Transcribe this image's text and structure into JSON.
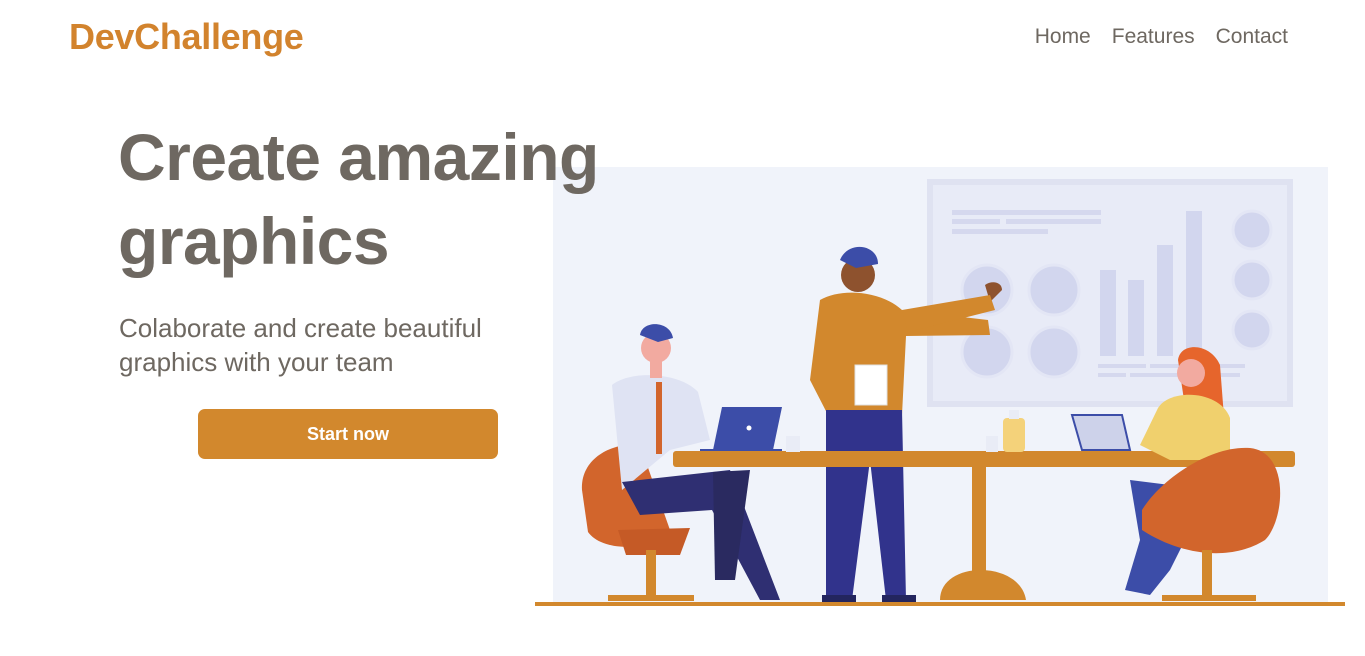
{
  "brand": {
    "name": "DevChallenge"
  },
  "nav": {
    "items": [
      {
        "label": "Home"
      },
      {
        "label": "Features"
      },
      {
        "label": "Contact"
      }
    ]
  },
  "hero": {
    "headline_line1": "Create amazing",
    "headline_line2": "graphics",
    "subtitle_line1": "Colaborate and create beautiful",
    "subtitle_line2": "graphics with your team",
    "cta_label": "Start now"
  },
  "colors": {
    "accent": "#d2832d",
    "text": "#6e6861",
    "button": "#d2882d",
    "illustration_bg": "#f0f3fa"
  },
  "illustration": {
    "subject": "team-meeting-presentation"
  }
}
